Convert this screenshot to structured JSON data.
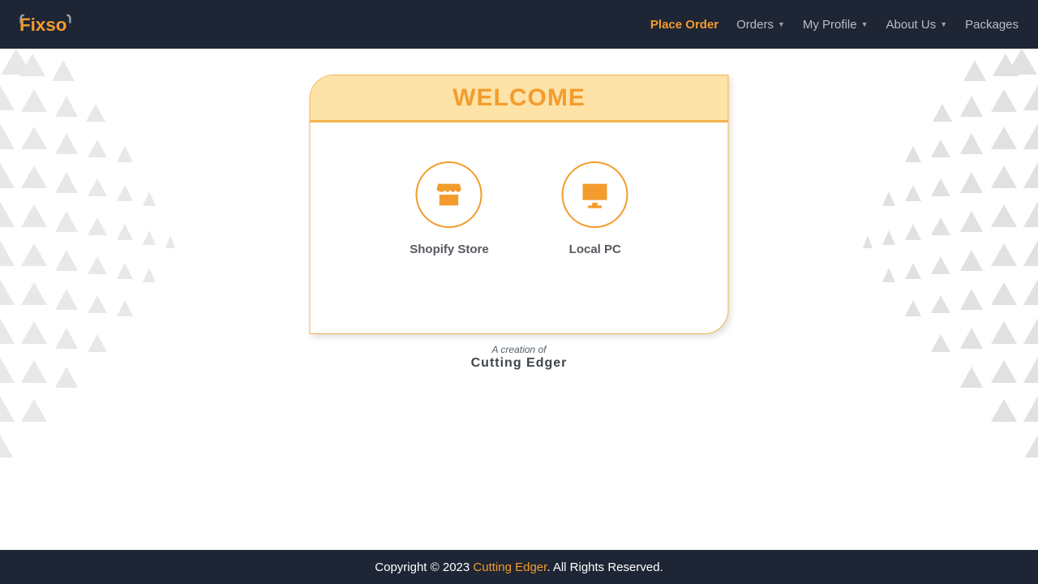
{
  "brand": "Fixso",
  "nav": {
    "place_order": "Place Order",
    "orders": "Orders",
    "my_profile": "My Profile",
    "about_us": "About Us",
    "packages": "Packages"
  },
  "card": {
    "title": "WELCOME",
    "options": {
      "shopify": "Shopify Store",
      "local_pc": "Local PC"
    }
  },
  "credit": {
    "line1": "A creation of",
    "line2": "Cutting  Edger"
  },
  "footer": {
    "prefix": "Copyright © 2023 ",
    "link": "Cutting Edger",
    "suffix": ". All Rights Reserved."
  },
  "colors": {
    "accent": "#f39c2c",
    "header_bg": "#1e2534",
    "card_border": "#f4b34d",
    "card_header_bg": "#fde3a8"
  }
}
